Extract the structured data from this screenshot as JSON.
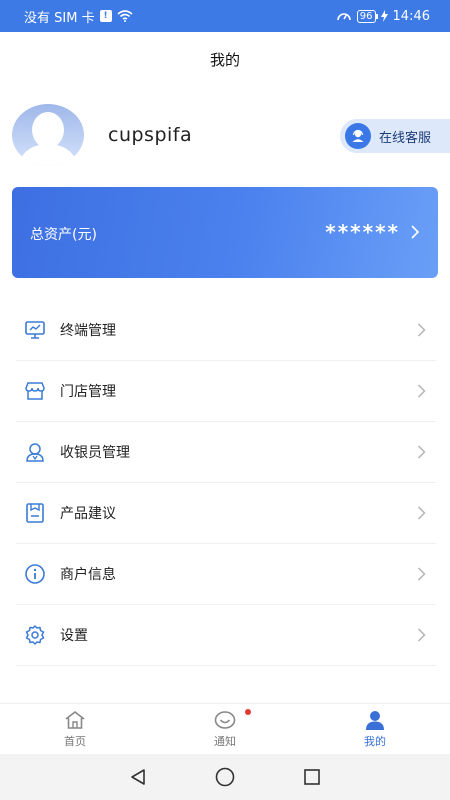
{
  "status_bar": {
    "carrier": "没有 SIM 卡",
    "sim_badge": "!",
    "battery": "96",
    "time": "14:46"
  },
  "header": {
    "title": "我的"
  },
  "profile": {
    "username": "cupspifa",
    "service_label": "在线客服"
  },
  "asset_card": {
    "label": "总资产(元)",
    "value": "******"
  },
  "menu": {
    "items": [
      {
        "label": "终端管理",
        "icon": "monitor-icon"
      },
      {
        "label": "门店管理",
        "icon": "store-icon"
      },
      {
        "label": "收银员管理",
        "icon": "user-icon"
      },
      {
        "label": "产品建议",
        "icon": "feedback-icon"
      },
      {
        "label": "商户信息",
        "icon": "info-icon"
      },
      {
        "label": "设置",
        "icon": "gear-icon"
      }
    ]
  },
  "tabs": {
    "items": [
      {
        "label": "首页",
        "icon": "home-icon"
      },
      {
        "label": "通知",
        "icon": "smile-icon"
      },
      {
        "label": "我的",
        "icon": "person-icon"
      }
    ]
  },
  "colors": {
    "primary": "#3d7ae5",
    "active_tab": "#3a6fd8",
    "badge": "#e53935"
  }
}
